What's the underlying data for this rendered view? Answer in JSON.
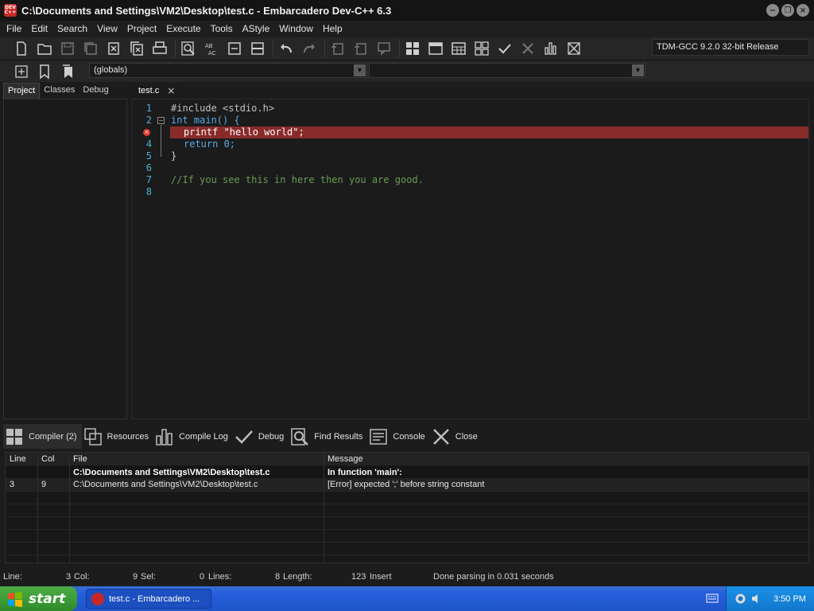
{
  "window": {
    "title": "C:\\Documents and Settings\\VM2\\Desktop\\test.c - Embarcadero Dev-C++ 6.3",
    "app_icon_text": "DEV C++",
    "minimize": "−",
    "maximize": "❐",
    "close": "×"
  },
  "menu": [
    "File",
    "Edit",
    "Search",
    "View",
    "Project",
    "Execute",
    "Tools",
    "AStyle",
    "Window",
    "Help"
  ],
  "toolbar": {
    "compiler": "TDM-GCC 9.2.0 32-bit Release",
    "scope_combo": "(globals)",
    "second_combo": ""
  },
  "left_panel": {
    "tabs": [
      "Project",
      "Classes",
      "Debug"
    ]
  },
  "editor": {
    "tab_label": "test.c",
    "lines": [
      {
        "num": "1",
        "text": "#include <stdio.h>"
      },
      {
        "num": "2",
        "text": "int main() {"
      },
      {
        "num": "3",
        "text": "printf \"hello world\";"
      },
      {
        "num": "4",
        "text": "return 0;"
      },
      {
        "num": "5",
        "text": "}"
      },
      {
        "num": "6",
        "text": ""
      },
      {
        "num": "7",
        "text": "//If you see this in here then you are good."
      },
      {
        "num": "8",
        "text": ""
      }
    ],
    "error_line": 3
  },
  "bottom_tabs": [
    "Compiler (2)",
    "Resources",
    "Compile Log",
    "Debug",
    "Find Results",
    "Console",
    "Close"
  ],
  "messages": {
    "columns": [
      "Line",
      "Col",
      "File",
      "Message"
    ],
    "rows": [
      {
        "line": "",
        "col": "",
        "file": "C:\\Documents and Settings\\VM2\\Desktop\\test.c",
        "message": "In function 'main':"
      },
      {
        "line": "3",
        "col": "9",
        "file": "C:\\Documents and Settings\\VM2\\Desktop\\test.c",
        "message": "[Error] expected ';' before string constant"
      }
    ]
  },
  "status": {
    "line_label": "Line:",
    "line_value": "3",
    "col_label": "Col:",
    "col_value": "9",
    "sel_label": "Sel:",
    "sel_value": "0",
    "lines_label": "Lines:",
    "lines_value": "8",
    "length_label": "Length:",
    "length_value": "123",
    "mode": "Insert",
    "message": "Done parsing in 0.031 seconds"
  },
  "taskbar": {
    "start_label": "start",
    "task_label": "test.c - Embarcadero ...",
    "clock": "3:50 PM"
  },
  "colors": {
    "error_line_bg": "#8a2b2b",
    "line_number": "#4fb0d6",
    "keyword": "#5ba8e6",
    "comment": "#6a9a52"
  }
}
